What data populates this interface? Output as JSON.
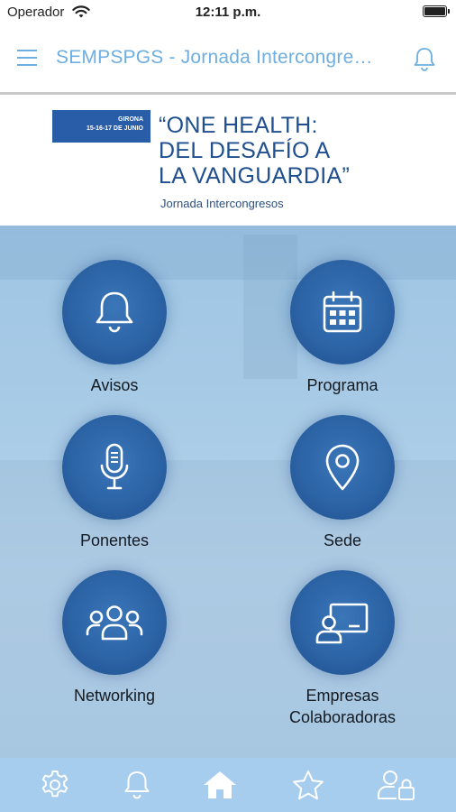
{
  "status": {
    "carrier": "Operador",
    "time": "12:11 p.m."
  },
  "header": {
    "title": "SEMPSPGS - Jornada Intercongresos"
  },
  "banner": {
    "box_line1": "GIRONA",
    "box_line2": "15-16-17 DE JUNIO",
    "title": "“ONE HEALTH:\nDEL DESAFÍO A\nLA VANGUARDIA”",
    "subtitle": "Jornada Intercongresos"
  },
  "menu": [
    {
      "label": "Avisos",
      "icon": "bell-icon"
    },
    {
      "label": "Programa",
      "icon": "calendar-icon"
    },
    {
      "label": "Ponentes",
      "icon": "microphone-icon"
    },
    {
      "label": "Sede",
      "icon": "location-pin-icon"
    },
    {
      "label": "Networking",
      "icon": "people-group-icon"
    },
    {
      "label": "Empresas\nColaboradoras",
      "icon": "presentation-board-icon"
    }
  ],
  "tabbar": [
    "gear-icon",
    "bell-icon",
    "home-icon",
    "star-icon",
    "user-lock-icon"
  ],
  "colors": {
    "accent": "#6eaee0",
    "circle": "#2c64a6",
    "tabbar": "#a7cdee",
    "banner_blue": "#2a5da8"
  }
}
